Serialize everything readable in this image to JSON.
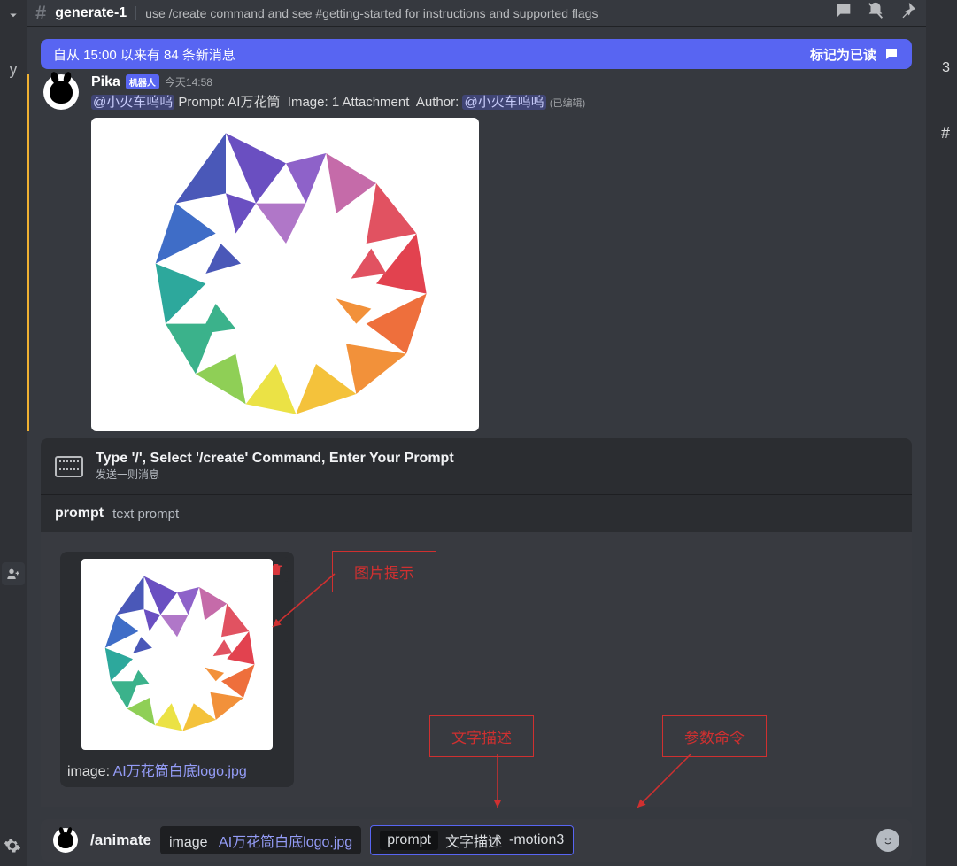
{
  "header": {
    "channel_name": "generate-1",
    "topic": "use /create command and see #getting-started for instructions and supported flags"
  },
  "new_messages_banner": {
    "text": "自从 15:00 以来有 84 条新消息",
    "mark_read": "标记为已读"
  },
  "message": {
    "author": "Pika",
    "bot_tag": "机器人",
    "timestamp": "今天14:58",
    "mention1": "@小火车呜呜",
    "prompt_label": "Prompt:",
    "prompt_value": "AI万花筒",
    "image_label": "Image:",
    "image_value": "1 Attachment",
    "author_label": "Author:",
    "mention2": "@小火车呜呜",
    "edited": "(已编辑)"
  },
  "reply_tip": {
    "title": "Type '/', Select '/create' Command, Enter Your Prompt",
    "sub": "发送一则消息"
  },
  "param": {
    "name": "prompt",
    "desc": "text prompt"
  },
  "upload": {
    "label_prefix": "image:",
    "filename": "AI万花筒白底logo.jpg"
  },
  "input": {
    "command": "/animate",
    "chip_image_key": "image",
    "chip_image_file": "AI万花筒白底logo.jpg",
    "chip_prompt_key": "prompt",
    "chip_prompt_text": "文字描述",
    "chip_prompt_motion": "-motion3"
  },
  "annotations": {
    "img_hint": "图片提示",
    "text_desc": "文字描述",
    "param_cmd": "参数命令"
  },
  "right_panel": {
    "count": "3",
    "hash": "#"
  },
  "left_panel": {
    "letter": "y"
  }
}
